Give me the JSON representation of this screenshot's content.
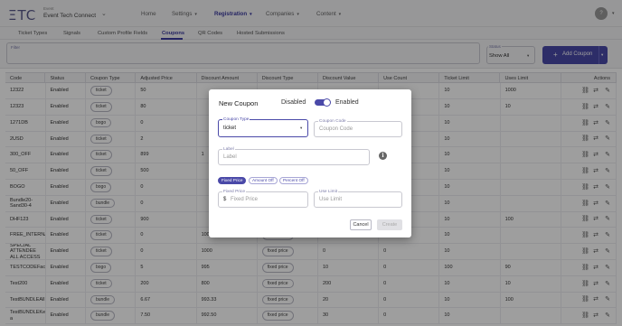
{
  "app": {
    "logo": "ΞTC",
    "event_label": "Event",
    "event_name": "Event Tech Connect",
    "avatar_initial": "?"
  },
  "nav": [
    {
      "label": "Home",
      "dropdown": false,
      "active": false
    },
    {
      "label": "Settings",
      "dropdown": true,
      "active": false
    },
    {
      "label": "Registration",
      "dropdown": true,
      "active": true
    },
    {
      "label": "Companies",
      "dropdown": true,
      "active": false
    },
    {
      "label": "Content",
      "dropdown": true,
      "active": false
    }
  ],
  "tabs": [
    "Ticket Types",
    "Signals",
    "Custom Profile Fields",
    "Coupons",
    "QR Codes",
    "Hosted Submissions"
  ],
  "active_tab": "Coupons",
  "filter": {
    "label": "Filter",
    "value": ""
  },
  "status": {
    "label": "Status",
    "value": "Show All"
  },
  "add_button": {
    "label": "Add Coupon"
  },
  "table": {
    "headers": [
      "Code",
      "Status",
      "Coupon Type",
      "Adjusted Price",
      "Discount Amount",
      "Discount Type",
      "Discount Value",
      "Use Count",
      "Ticket Limit",
      "Uses Limit",
      "Actions"
    ],
    "rows": [
      [
        "12322",
        "Enabled",
        "ticket",
        "50",
        "",
        "",
        "",
        "",
        "10",
        "1000"
      ],
      [
        "12323",
        "Enabled",
        "ticket",
        "80",
        "",
        "",
        "",
        "",
        "10",
        "10"
      ],
      [
        "1271DB",
        "Enabled",
        "bogo",
        "0",
        "",
        "",
        "",
        "",
        "10",
        ""
      ],
      [
        "2USD",
        "Enabled",
        "ticket",
        "2",
        "",
        "",
        "",
        "",
        "10",
        ""
      ],
      [
        "300_OFF",
        "Enabled",
        "ticket",
        "899",
        "1",
        "",
        "",
        "",
        "10",
        ""
      ],
      [
        "50_OFF",
        "Enabled",
        "ticket",
        "500",
        "",
        "",
        "",
        "",
        "10",
        ""
      ],
      [
        "BOGO",
        "Enabled",
        "bogo",
        "0",
        "",
        "",
        "",
        "",
        "10",
        ""
      ],
      [
        "Bundle20-Sand30-4",
        "Enabled",
        "bundle",
        "0",
        "",
        "",
        "",
        "",
        "10",
        ""
      ],
      [
        "DHF123",
        "Enabled",
        "ticket",
        "900",
        "",
        "",
        "",
        "",
        "10",
        "100"
      ],
      [
        "FREE_INTERNAL",
        "Enabled",
        "ticket",
        "0",
        "1000",
        "percent off",
        "100%",
        "0",
        "10",
        ""
      ],
      [
        "SPECIAL ATTENDEE ALL ACCESS",
        "Enabled",
        "ticket",
        "0",
        "1000",
        "fixed price",
        "0",
        "0",
        "10",
        ""
      ],
      [
        "TESTCODEFaculT",
        "Enabled",
        "bogo",
        "5",
        "995",
        "fixed price",
        "10",
        "0",
        "100",
        "90"
      ],
      [
        "Test200",
        "Enabled",
        "ticket",
        "200",
        "800",
        "fixed price",
        "200",
        "0",
        "10",
        "10"
      ],
      [
        "TestBUNDLEAllIn",
        "Enabled",
        "bundle",
        "6.67",
        "993.33",
        "fixed price",
        "20",
        "0",
        "10",
        "100"
      ],
      [
        "TestBUNDLEKeio a",
        "Enabled",
        "bundle",
        "7.50",
        "992.50",
        "fixed price",
        "30",
        "0",
        "10",
        ""
      ]
    ]
  },
  "modal": {
    "title": "New Coupon",
    "toggle_off_label": "Disabled",
    "toggle_on_label": "Enabled",
    "toggle_on": true,
    "coupon_type": {
      "label": "Coupon Type",
      "value": "ticket"
    },
    "coupon_code": {
      "label": "Coupon Code",
      "placeholder": "Coupon Code"
    },
    "label_field": {
      "label": "Label",
      "placeholder": "Label"
    },
    "info_icon": "i",
    "price_modes": [
      {
        "label": "Fixed Price",
        "selected": true
      },
      {
        "label": "Amount Off",
        "selected": false
      },
      {
        "label": "Percent Off",
        "selected": false
      }
    ],
    "fixed_price": {
      "label": "Fixed Price",
      "prefix": "$",
      "placeholder": "Fixed Price"
    },
    "use_limit": {
      "label": "Use Limit",
      "placeholder": "Use Limit"
    },
    "cancel_label": "Cancel",
    "create_label": "Create"
  },
  "colors": {
    "accent": "#4a49a8",
    "topbar_bg": "#f4f4f6",
    "overlay": "rgba(0,0,0,0.38)"
  },
  "icons": [
    "link-icon",
    "share-icon",
    "edit-icon"
  ]
}
